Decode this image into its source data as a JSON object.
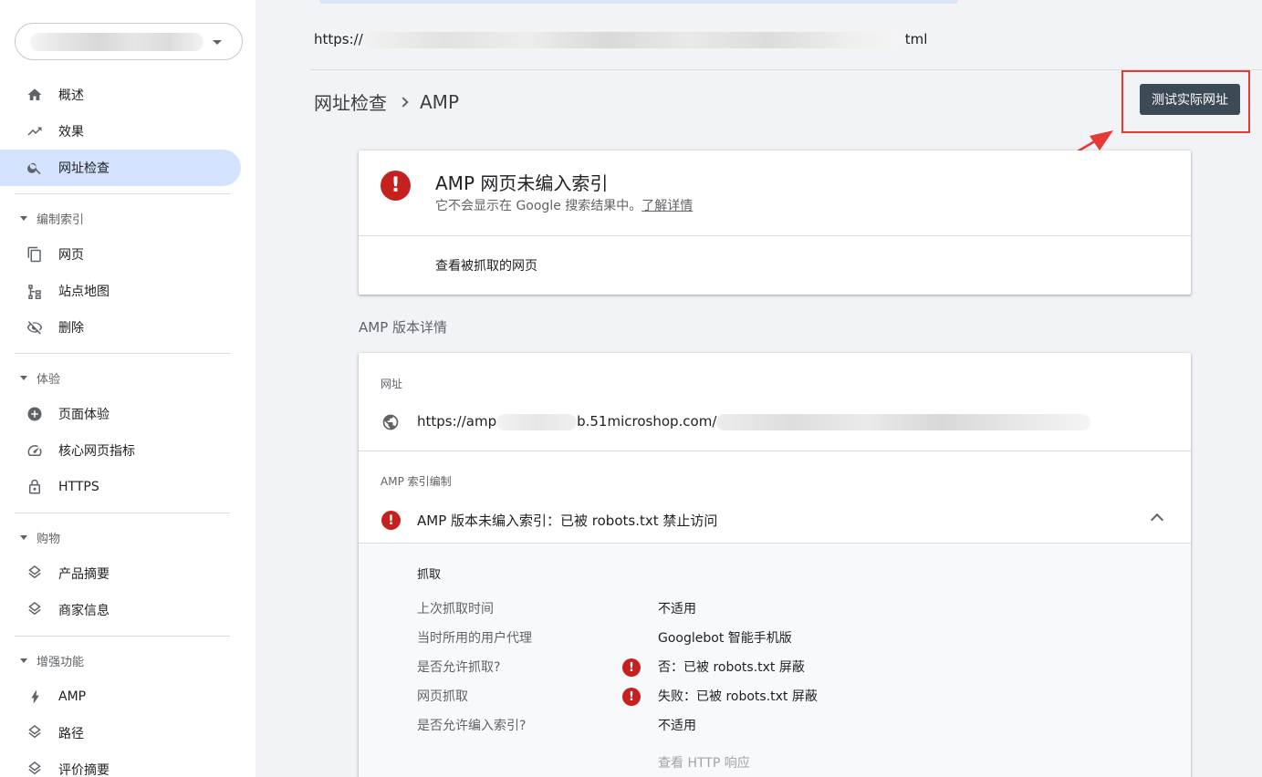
{
  "sidebar": {
    "nav": [
      {
        "label": "概述",
        "icon": "home-icon"
      },
      {
        "label": "效果",
        "icon": "trending-up-icon"
      },
      {
        "label": "网址检查",
        "icon": "search-icon",
        "active": true
      }
    ],
    "sections": [
      {
        "title": "编制索引",
        "items": [
          {
            "label": "网页",
            "icon": "pages-icon"
          },
          {
            "label": "站点地图",
            "icon": "sitemap-icon"
          },
          {
            "label": "删除",
            "icon": "visibility-off-icon"
          }
        ]
      },
      {
        "title": "体验",
        "items": [
          {
            "label": "页面体验",
            "icon": "page-experience-icon"
          },
          {
            "label": "核心网页指标",
            "icon": "speed-icon"
          },
          {
            "label": "HTTPS",
            "icon": "lock-icon"
          }
        ]
      },
      {
        "title": "购物",
        "items": [
          {
            "label": "产品摘要",
            "icon": "layers-icon"
          },
          {
            "label": "商家信息",
            "icon": "layers-icon"
          }
        ]
      },
      {
        "title": "增强功能",
        "items": [
          {
            "label": "AMP",
            "icon": "bolt-icon"
          },
          {
            "label": "路径",
            "icon": "layers-icon"
          },
          {
            "label": "评价摘要",
            "icon": "layers-icon"
          }
        ]
      }
    ]
  },
  "header": {
    "url_prefix": "https://",
    "url_suffix": "tml",
    "breadcrumb_root": "网址检查",
    "breadcrumb_current": "AMP",
    "test_button": "测试实际网址"
  },
  "status_card": {
    "title": "AMP 网页未编入索引",
    "subtitle": "它不会显示在 Google 搜索结果中。",
    "learn_more": "了解详情",
    "view_crawled": "查看被抓取的网页"
  },
  "amp_details": {
    "section_title": "AMP 版本详情",
    "url_label": "网址",
    "url_prefix": "https://amp",
    "url_middle": "b.51microshop.com/",
    "indexing_label": "AMP 索引编制",
    "indexing_status": "AMP 版本未编入索引：已被 robots.txt 禁止访问",
    "crawl_heading": "抓取",
    "rows": [
      {
        "key": "上次抓取时间",
        "value": "不适用",
        "error": false
      },
      {
        "key": "当时所用的用户代理",
        "value": "Googlebot 智能手机版",
        "error": false
      },
      {
        "key": "是否允许抓取?",
        "value": "否：已被 robots.txt 屏蔽",
        "error": true
      },
      {
        "key": "网页抓取",
        "value": "失败：已被 robots.txt 屏蔽",
        "error": true
      },
      {
        "key": "是否允许编入索引?",
        "value": "不适用",
        "error": false
      }
    ],
    "http_response": "查看 HTTP 响应"
  },
  "colors": {
    "active_nav": "#d3e3fd",
    "error": "#c5221f",
    "button": "#3c4a55",
    "annotation": "#e53935"
  }
}
